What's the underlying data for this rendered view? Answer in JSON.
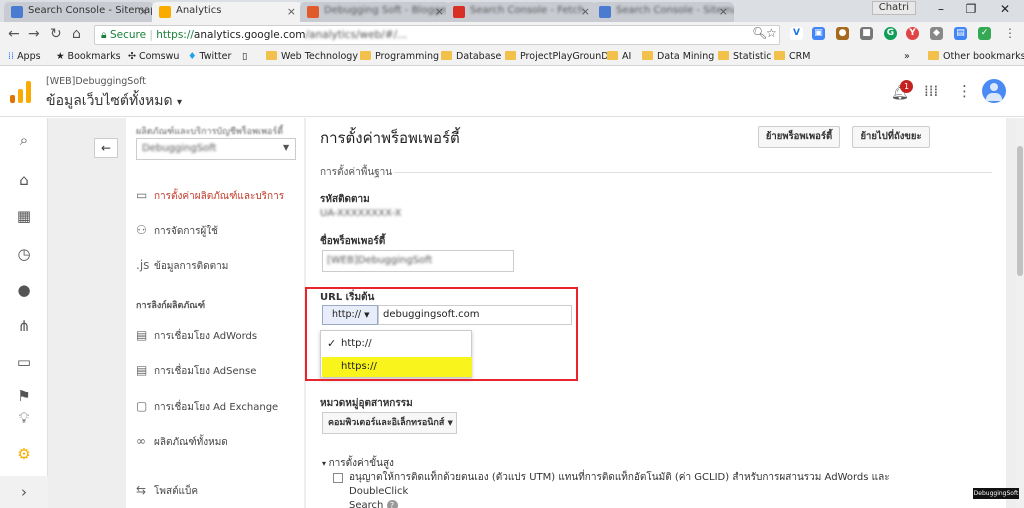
{
  "tabs": [
    {
      "title": "Search Console - Sitemap",
      "active": false
    },
    {
      "title": "Analytics",
      "active": true
    },
    {
      "title": "Debugging Soft - Blogger",
      "active": false
    },
    {
      "title": "Search Console - Fetch",
      "active": false
    },
    {
      "title": "Search Console - Sitemap",
      "active": false
    }
  ],
  "window_user": "Chatri",
  "address": {
    "secure_label": "Secure",
    "scheme": "https://",
    "host": "analytics.google.com",
    "rest": "/analytics/web/#/..."
  },
  "bookmarks": [
    "Apps",
    "Bookmarks",
    "Comswu",
    "Twitter",
    "",
    "Web Technology",
    "Programming",
    "Database",
    "ProjectPlayGrounD",
    "AI",
    "Data Mining",
    "Statistic",
    "CRM"
  ],
  "bookmarks_more": "»",
  "bookmarks_other": "Other bookmarks",
  "header": {
    "account": "[WEB]DebuggingSoft",
    "property": "ข้อมูลเว็บไซต์ทั้งหมด",
    "notification_count": "1"
  },
  "nav": {
    "heading": "ผลิตภัณฑ์และบริการบัญชีพร็อพเพอร์ตี้",
    "selector_value": "DebuggingSoft",
    "items": [
      {
        "label": "การตั้งค่าผลิตภัณฑ์และบริการ",
        "icon": "▭",
        "selected": true
      },
      {
        "label": "การจัดการผู้ใช้",
        "icon": "⚇",
        "selected": false
      },
      {
        "label": "ข้อมูลการติดตาม",
        "icon": ".js",
        "selected": false
      }
    ],
    "section": "การลิงก์ผลิตภัณฑ์",
    "links": [
      {
        "label": "การเชื่อมโยง AdWords",
        "icon": "▤"
      },
      {
        "label": "การเชื่อมโยง AdSense",
        "icon": "▤"
      },
      {
        "label": "การเชื่อมโยง Ad Exchange",
        "icon": "▢"
      },
      {
        "label": "ผลิตภัณฑ์ทั้งหมด",
        "icon": "∞"
      }
    ],
    "bottom": "โพสต์แบ็ค"
  },
  "main": {
    "title": "การตั้งค่าพร็อพเพอร์ตี้",
    "move_property_btn": "ย้ายพร็อพเพอร์ตี้",
    "trash_btn": "ย้ายไปที่ถังขยะ",
    "basic_settings": "การตั้งค่าพื้นฐาน",
    "tracking_id_label": "รหัสติดตาม",
    "tracking_id_value": "UA-XXXXXXXX-X",
    "property_name_label": "ชื่อพร็อพเพอร์ตี้",
    "property_name_value": "[WEB]DebuggingSoft",
    "default_url_label": "URL เริ่มต้น",
    "scheme_value": "http://",
    "url_value": "debuggingsoft.com",
    "scheme_options": [
      "http://",
      "https://"
    ],
    "industry_label": "หมวดหมู่อุตสาหกรรม",
    "industry_value": "คอมพิวเตอร์และอิเล็กทรอนิกส์",
    "advanced_label": "การตั้งค่าขั้นสูง",
    "manual_tag_text": "อนุญาตให้การติดแท็กด้วยตนเอง (ตัวแปร UTM) แทนที่การติดแท็กอัตโนมัติ (ค่า GCLID) สำหรับการผสานรวม AdWords และ DoubleClick",
    "manual_tag_search": "Search"
  },
  "watermark": "DebuggingSoft",
  "colors": {
    "accent_red": "#c53929",
    "highlight": "#f8f41c",
    "annotation": "#e8242c",
    "logo_orange": "#f9ab00",
    "logo_dark": "#e37400",
    "badge": "#c5221f"
  }
}
